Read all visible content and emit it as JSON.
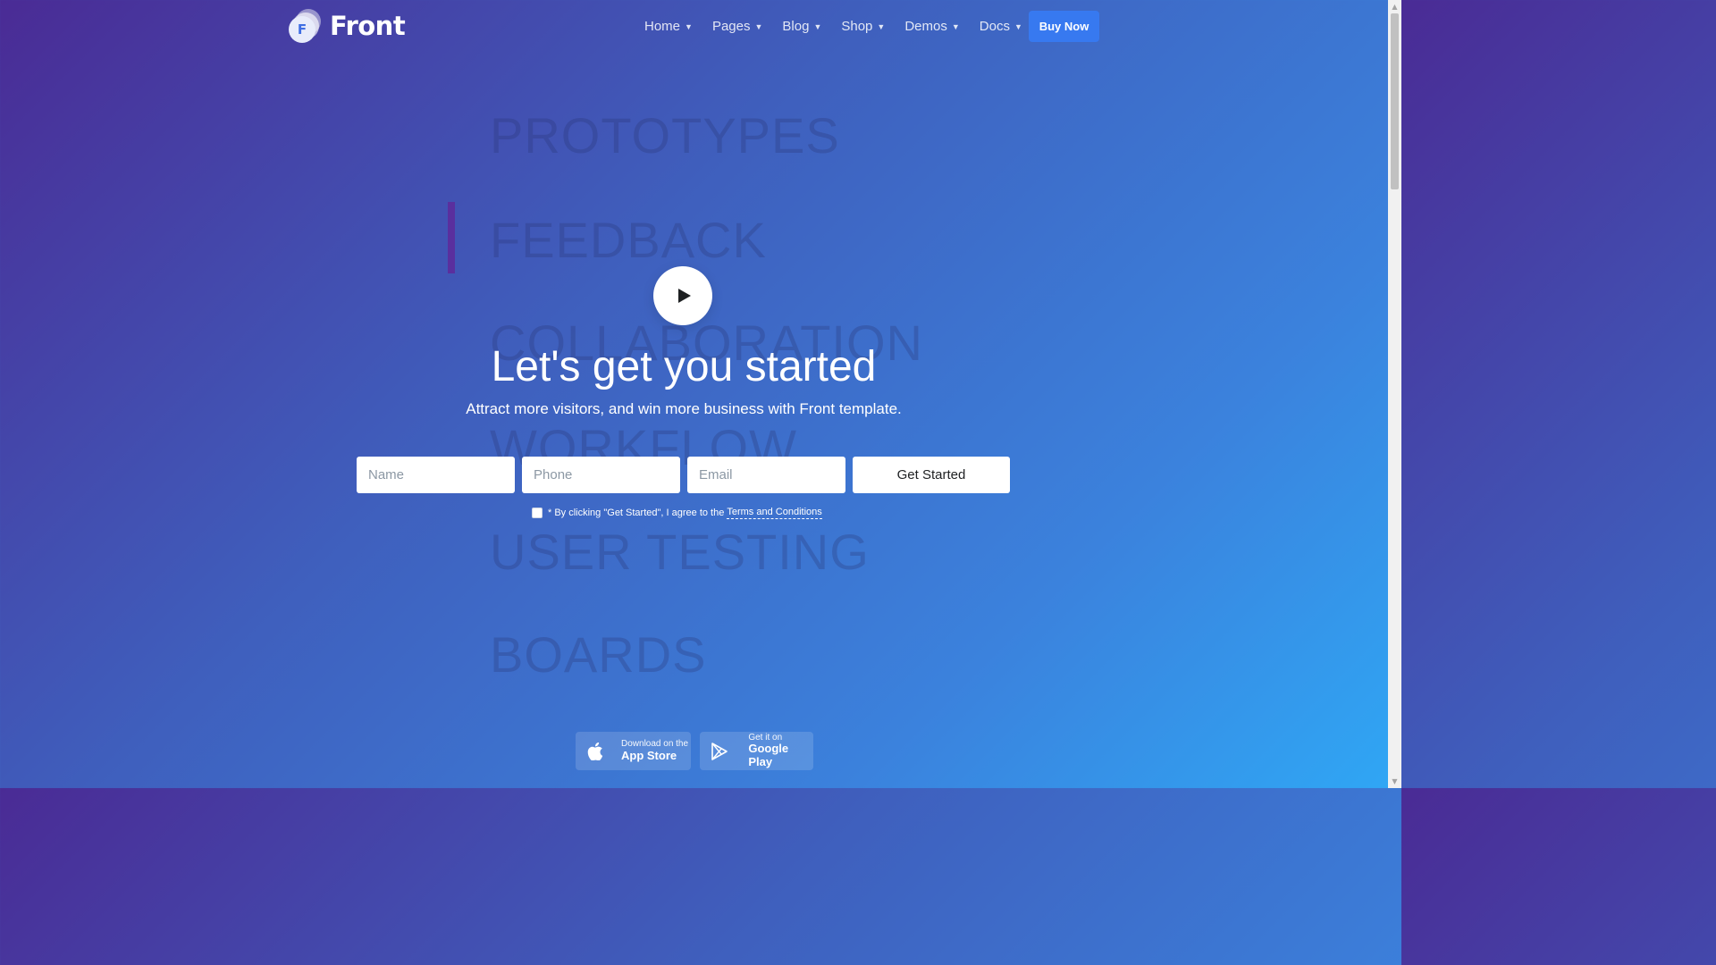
{
  "brand": {
    "name": "Front",
    "logo_letter": "F"
  },
  "nav": {
    "items": [
      {
        "label": "Home"
      },
      {
        "label": "Pages"
      },
      {
        "label": "Blog"
      },
      {
        "label": "Shop"
      },
      {
        "label": "Demos"
      },
      {
        "label": "Docs"
      }
    ],
    "buy_label": "Buy Now"
  },
  "background_words": [
    "PROTOTYPES",
    "FEEDBACK",
    "COLLABORATION",
    "WORKFLOW",
    "USER TESTING",
    "BOARDS"
  ],
  "hero": {
    "title": "Let's get you started",
    "subtitle": "Attract more visitors, and win more business with Front template."
  },
  "form": {
    "name_placeholder": "Name",
    "phone_placeholder": "Phone",
    "email_placeholder": "Email",
    "submit_label": "Get Started",
    "terms_prefix": "* By clicking \"Get Started\", I agree to the",
    "terms_link": "Terms and Conditions"
  },
  "stores": {
    "apple": {
      "small": "Download on the",
      "big": "App Store",
      "icon": "apple-icon"
    },
    "google": {
      "small": "Get it on",
      "big": "Google Play",
      "icon": "google-play-icon"
    }
  },
  "colors": {
    "gradient_start": "#4a2b95",
    "gradient_end": "#2fa7f5",
    "primary": "#3779f0",
    "cursor": "#5a2f9e"
  }
}
